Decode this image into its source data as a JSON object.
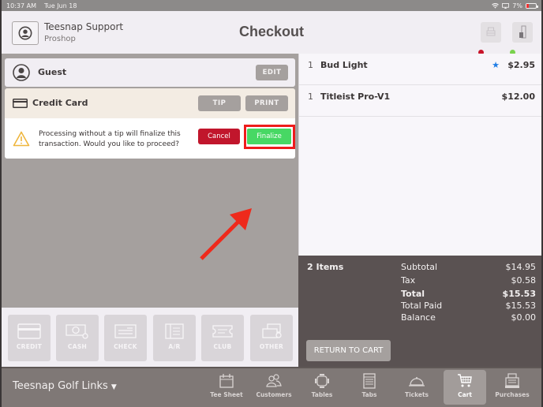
{
  "status_bar": {
    "time": "10:37 AM",
    "date": "Tue Jun 18",
    "battery": "7%",
    "icons": [
      "wifi-icon",
      "screen-mirror-icon",
      "battery-charging-icon"
    ]
  },
  "header": {
    "user_name": "Teesnap Support",
    "user_role": "Proshop",
    "title": "Checkout",
    "printer_status_color": "#c8142a",
    "reader_status_color": "#7ad24e"
  },
  "left": {
    "guest_label": "Guest",
    "edit_label": "EDIT",
    "payment_label": "Credit Card",
    "tip_label": "TIP",
    "print_label": "PRINT",
    "confirm_message": "Processing without a tip will finalize this transaction. Would you like to proceed?",
    "cancel_label": "Cancel",
    "finalize_label": "Finalize",
    "tenders": [
      {
        "label": "CREDIT",
        "icon": "credit-card-icon"
      },
      {
        "label": "CASH",
        "icon": "cash-icon"
      },
      {
        "label": "CHECK",
        "icon": "check-icon"
      },
      {
        "label": "A/R",
        "icon": "ledger-icon"
      },
      {
        "label": "CLUB",
        "icon": "ticket-icon"
      },
      {
        "label": "OTHER",
        "icon": "other-payment-icon"
      }
    ]
  },
  "cart": {
    "items": [
      {
        "qty": "1",
        "name": "Bud Light",
        "price": "$2.95",
        "starred": true
      },
      {
        "qty": "1",
        "name": "Titleist Pro-V1",
        "price": "$12.00",
        "starred": false
      }
    ],
    "items_count": "2 Items",
    "totals": [
      {
        "label": "Subtotal",
        "value": "$14.95",
        "bold": false
      },
      {
        "label": "Tax",
        "value": "$0.58",
        "bold": false
      },
      {
        "label": "Total",
        "value": "$15.53",
        "bold": true
      },
      {
        "label": "Total Paid",
        "value": "$15.53",
        "bold": false
      },
      {
        "label": "Balance",
        "value": "$0.00",
        "bold": false
      }
    ],
    "return_label": "RETURN TO CART"
  },
  "bottom_nav": {
    "location": "Teesnap Golf Links",
    "items": [
      {
        "label": "Tee Sheet",
        "icon": "calendar-icon",
        "active": false
      },
      {
        "label": "Customers",
        "icon": "customers-icon",
        "active": false
      },
      {
        "label": "Tables",
        "icon": "table-icon",
        "active": false
      },
      {
        "label": "Tabs",
        "icon": "tabs-icon",
        "active": false
      },
      {
        "label": "Tickets",
        "icon": "cloche-icon",
        "active": false
      },
      {
        "label": "Cart",
        "icon": "cart-icon",
        "active": true
      },
      {
        "label": "Purchases",
        "icon": "register-icon",
        "active": false
      }
    ]
  },
  "colors": {
    "cancel": "#c1162c",
    "finalize": "#47d864",
    "highlight": "#ee1c1c",
    "star": "#1f7de5"
  }
}
